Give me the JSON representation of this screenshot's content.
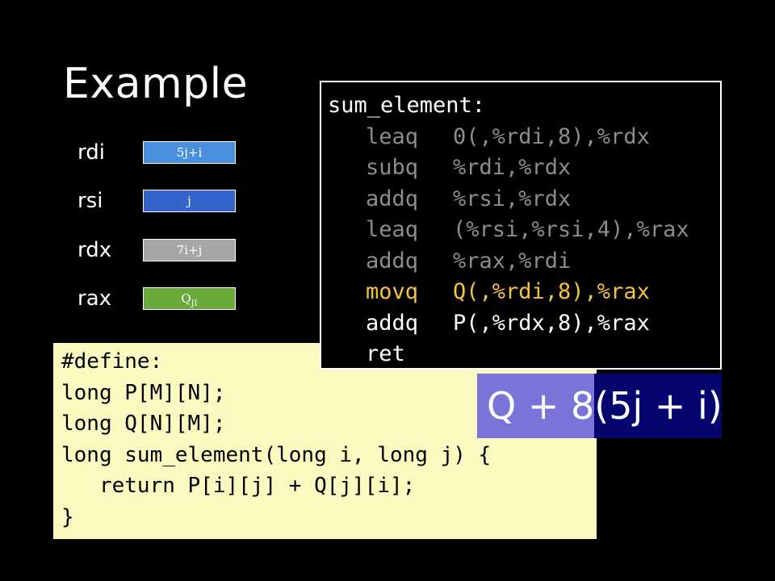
{
  "title": "Example",
  "registers": [
    {
      "name": "rdi",
      "value": "5j+i",
      "color": "#4a8fdc"
    },
    {
      "name": "rsi",
      "value": "j",
      "color": "#3663c9"
    },
    {
      "name": "rdx",
      "value": "7i+j",
      "color": "#a6a6a6"
    },
    {
      "name": "rax",
      "value": "QJI",
      "color": "#6aaa3a"
    }
  ],
  "assembly": {
    "label": "sum_element:",
    "lines": [
      {
        "op": "leaq",
        "args": "0(,%rdi,8),%rdx",
        "color": "#8c8c8c"
      },
      {
        "op": "subq",
        "args": "%rdi,%rdx",
        "color": "#8c8c8c"
      },
      {
        "op": "addq",
        "args": "%rsi,%rdx",
        "color": "#8c8c8c"
      },
      {
        "op": "leaq",
        "args": "(%rsi,%rsi,4),%rax",
        "color": "#8c8c8c"
      },
      {
        "op": "addq",
        "args": "%rax,%rdi",
        "color": "#8c8c8c"
      },
      {
        "op": "movq",
        "args": "Q(,%rdi,8),%rax",
        "color": "#f5c342"
      },
      {
        "op": "addq",
        "args": "P(,%rdx,8),%rax",
        "color": "#ffffff"
      },
      {
        "op": "ret",
        "args": "",
        "color": "#ffffff"
      }
    ]
  },
  "c_code": [
    "#define:",
    "long P[M][N];",
    "long Q[N][M];",
    "long sum_element(long i, long j) {",
    "   return P[i][j] + Q[j][i];",
    "}"
  ],
  "formula": {
    "part1": "Q + 8",
    "part2": "(5j + i)"
  }
}
